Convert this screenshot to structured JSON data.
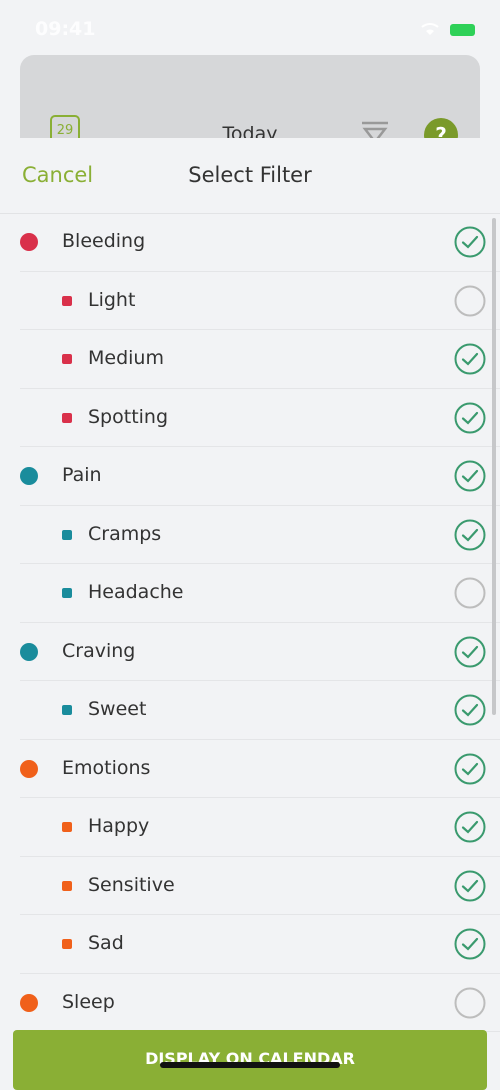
{
  "status_bar": {
    "time": "09:41"
  },
  "background_screen": {
    "calendar_day": "29",
    "title": "Today",
    "help": "?"
  },
  "header": {
    "cancel": "Cancel",
    "title": "Select Filter"
  },
  "colors": {
    "accent": "#8aaf35",
    "check": "#3a9a6e",
    "bleeding": "#d9304a",
    "pain": "#1a8c9c",
    "emotions": "#f0601a"
  },
  "filters": [
    {
      "label": "Bleeding",
      "level": "category",
      "color": "#d9304a",
      "checked": true
    },
    {
      "label": "Light",
      "level": "sub",
      "color": "#d9304a",
      "checked": false
    },
    {
      "label": "Medium",
      "level": "sub",
      "color": "#d9304a",
      "checked": true
    },
    {
      "label": "Spotting",
      "level": "sub",
      "color": "#d9304a",
      "checked": true
    },
    {
      "label": "Pain",
      "level": "category",
      "color": "#1a8c9c",
      "checked": true
    },
    {
      "label": "Cramps",
      "level": "sub",
      "color": "#1a8c9c",
      "checked": true
    },
    {
      "label": "Headache",
      "level": "sub",
      "color": "#1a8c9c",
      "checked": false
    },
    {
      "label": "Craving",
      "level": "category",
      "color": "#1a8c9c",
      "checked": true
    },
    {
      "label": "Sweet",
      "level": "sub",
      "color": "#1a8c9c",
      "checked": true
    },
    {
      "label": "Emotions",
      "level": "category",
      "color": "#f0601a",
      "checked": true
    },
    {
      "label": "Happy",
      "level": "sub",
      "color": "#f0601a",
      "checked": true
    },
    {
      "label": "Sensitive",
      "level": "sub",
      "color": "#f0601a",
      "checked": true
    },
    {
      "label": "Sad",
      "level": "sub",
      "color": "#f0601a",
      "checked": true
    },
    {
      "label": "Sleep",
      "level": "category",
      "color": "#f0601a",
      "checked": false
    }
  ],
  "footer": {
    "button": "DISPLAY ON CALENDAR"
  }
}
